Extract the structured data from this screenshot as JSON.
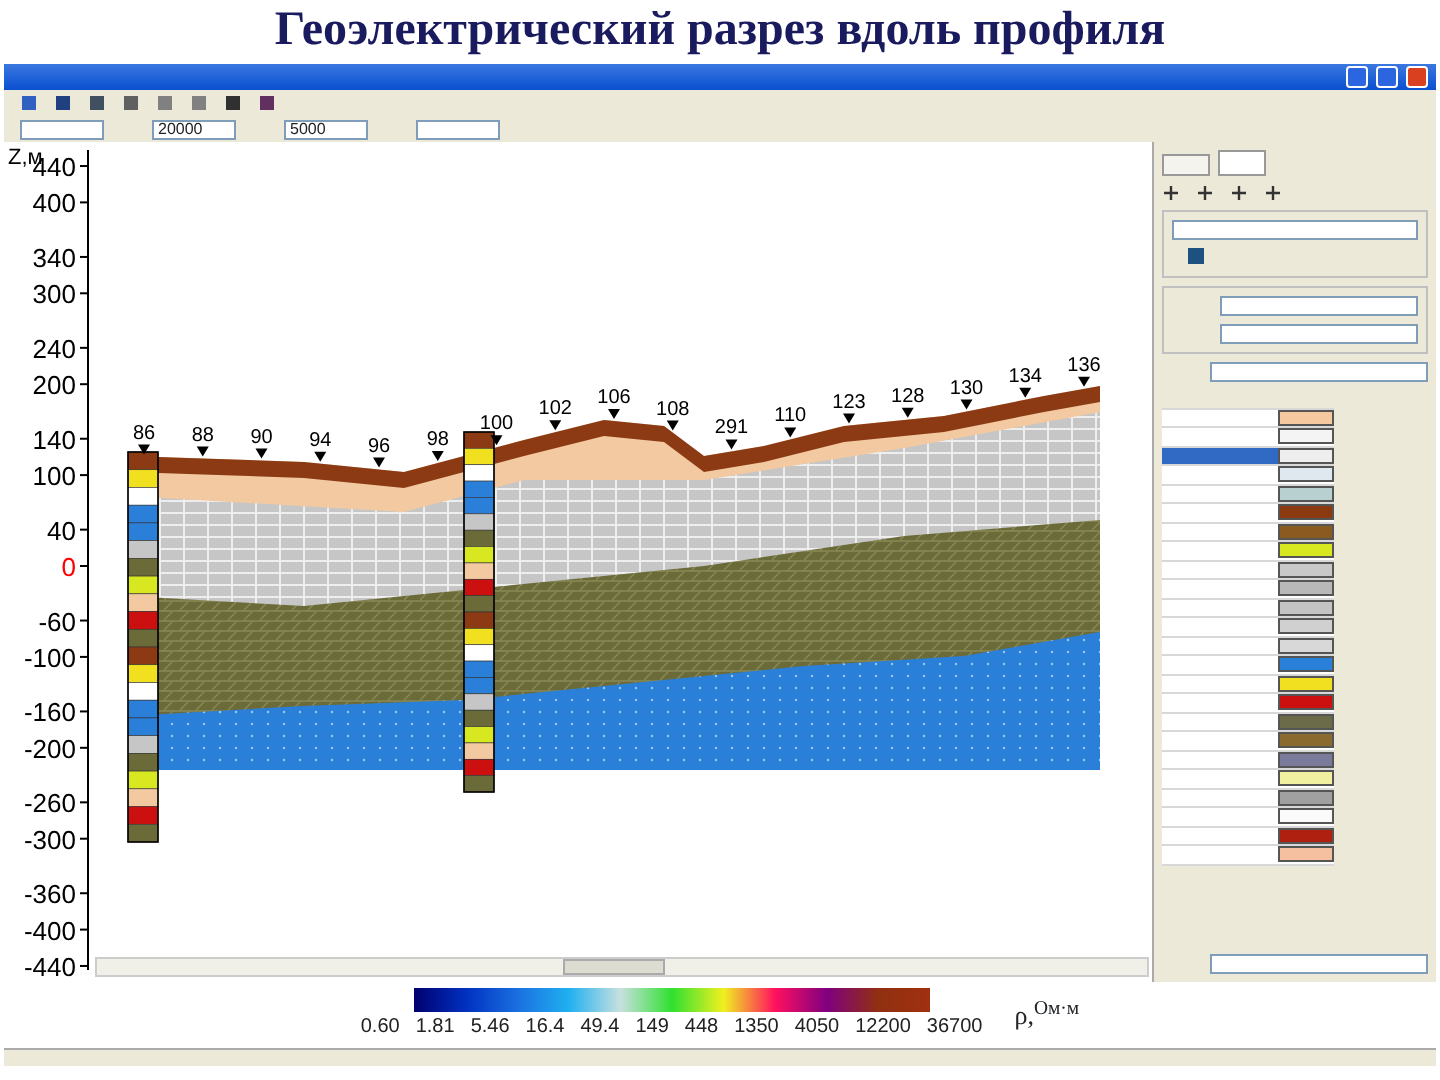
{
  "slide_title": "Геоэлектрический разрез вдоль профиля",
  "toolbar_fields": [
    {
      "value": "20000"
    },
    {
      "value": "5000"
    }
  ],
  "axis": {
    "unit_label": "Z,м",
    "ticks": [
      {
        "label": "440",
        "color": "#000000"
      },
      {
        "label": "400",
        "color": "#000000"
      },
      {
        "label": "340",
        "color": "#000000"
      },
      {
        "label": "300",
        "color": "#000000"
      },
      {
        "label": "240",
        "color": "#000000"
      },
      {
        "label": "200",
        "color": "#000000"
      },
      {
        "label": "140",
        "color": "#000000"
      },
      {
        "label": "100",
        "color": "#000000"
      },
      {
        "label": "40",
        "color": "#000000"
      },
      {
        "label": "0",
        "color": "#ff0000"
      },
      {
        "label": "-60",
        "color": "#000000"
      },
      {
        "label": "-100",
        "color": "#000000"
      },
      {
        "label": "-160",
        "color": "#000000"
      },
      {
        "label": "-200",
        "color": "#000000"
      },
      {
        "label": "-260",
        "color": "#000000"
      },
      {
        "label": "-300",
        "color": "#000000"
      },
      {
        "label": "-360",
        "color": "#000000"
      },
      {
        "label": "-400",
        "color": "#000000"
      },
      {
        "label": "-440",
        "color": "#000000"
      }
    ]
  },
  "stations": [
    "86",
    "88",
    "90",
    "94",
    "96",
    "98",
    "100",
    "102",
    "106",
    "108",
    "291",
    "110",
    "123",
    "128",
    "130",
    "134",
    "136"
  ],
  "panel": {
    "tabs": [
      {
        "selected": false
      },
      {
        "selected": true
      }
    ],
    "checkbox": {
      "checked": true
    },
    "legend_rows": [
      {
        "color": "#f5c8a0",
        "selected": false
      },
      {
        "color": "#f4f4f4",
        "selected": false
      },
      {
        "color": "#eeeeee",
        "selected": true
      },
      {
        "color": "#dfe8ef",
        "selected": false
      },
      {
        "color": "#b8d0d0",
        "selected": false
      },
      {
        "color": "#8b3a10",
        "selected": false
      },
      {
        "color": "#8b5a20",
        "selected": false
      },
      {
        "color": "#d8e820",
        "selected": false
      },
      {
        "color": "#c8c8c8",
        "selected": false
      },
      {
        "color": "#b8b8b8",
        "selected": false
      },
      {
        "color": "#c4c4c4",
        "selected": false
      },
      {
        "color": "#d0d0d0",
        "selected": false
      },
      {
        "color": "#d8d8d8",
        "selected": false
      },
      {
        "color": "#2a7fd8",
        "selected": false
      },
      {
        "color": "#f0e020",
        "selected": false
      },
      {
        "color": "#cc1010",
        "selected": false
      },
      {
        "color": "#6b6b4a",
        "selected": false
      },
      {
        "color": "#8b6a30",
        "selected": false
      },
      {
        "color": "#7a7a9a",
        "selected": false
      },
      {
        "color": "#f0f0a0",
        "selected": false
      },
      {
        "color": "#a0a0a0",
        "selected": false
      },
      {
        "color": "#fafafa",
        "selected": false
      },
      {
        "color": "#b02010",
        "selected": false
      },
      {
        "color": "#f5c0a0",
        "selected": false
      }
    ]
  },
  "colorbar": {
    "labels": [
      "0.60",
      "1.81",
      "5.46",
      "16.4",
      "49.4",
      "149",
      "448",
      "1350",
      "4050",
      "12200",
      "36700"
    ],
    "unit": "ρ,$^{Ом·м}$"
  }
}
